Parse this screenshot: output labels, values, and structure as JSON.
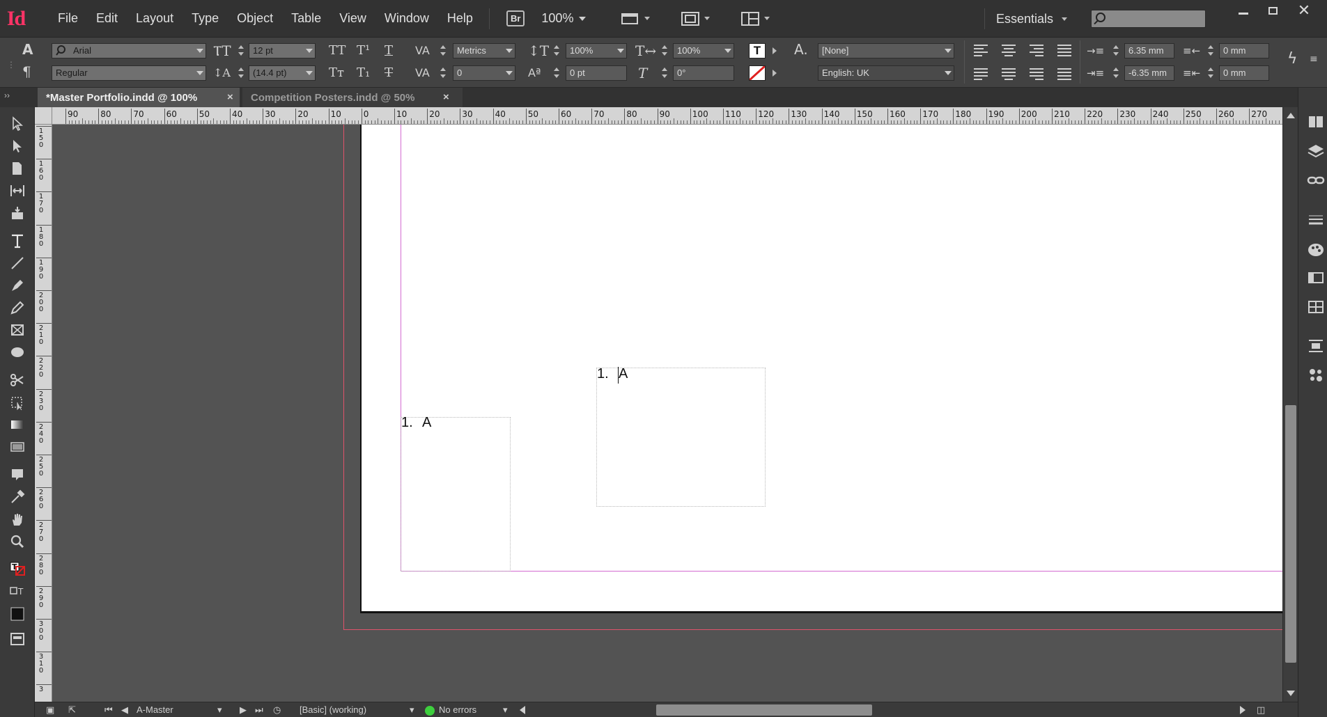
{
  "app": {
    "logo": "Id"
  },
  "menu": {
    "items": [
      "File",
      "Edit",
      "Layout",
      "Type",
      "Object",
      "Table",
      "View",
      "Window",
      "Help"
    ],
    "bridge_button": "Br",
    "zoom": "100%",
    "workspace": "Essentials",
    "search_placeholder": ""
  },
  "control_panel": {
    "char_mode_glyph": "A",
    "para_mode_glyph": "¶",
    "font_family": "Arial",
    "font_style": "Regular",
    "font_size": "12 pt",
    "leading": "(14.4 pt)",
    "kerning": "Metrics",
    "tracking": "0",
    "vertical_scale": "100%",
    "horizontal_scale": "100%",
    "baseline_shift": "0 pt",
    "skew": "0°",
    "char_style": "[None]",
    "language": "English: UK",
    "left_indent": "6.35 mm",
    "first_line_indent": "-6.35 mm",
    "right_indent": "0 mm",
    "last_line_indent": "0 mm"
  },
  "tabs": [
    {
      "label": "*Master Portfolio.indd @ 100%",
      "active": true
    },
    {
      "label": "Competition Posters.indd @ 50%",
      "active": false
    }
  ],
  "ruler_h": [
    "90",
    "80",
    "70",
    "60",
    "50",
    "40",
    "30",
    "20",
    "10",
    "0",
    "10",
    "20",
    "30",
    "40",
    "50",
    "60",
    "70",
    "80",
    "90",
    "100",
    "110",
    "120",
    "130",
    "140",
    "150",
    "160",
    "170",
    "180",
    "190",
    "200",
    "210",
    "220",
    "230",
    "240",
    "250",
    "260",
    "270"
  ],
  "ruler_v": [
    "150",
    "160",
    "170",
    "180",
    "190",
    "200",
    "210",
    "220",
    "230",
    "240",
    "250",
    "260",
    "270",
    "280",
    "290",
    "300",
    "310",
    "3"
  ],
  "frames": [
    {
      "number": "1.",
      "text": "A"
    },
    {
      "number": "1.",
      "text": "A"
    }
  ],
  "status": {
    "page": "A-Master",
    "preflight_profile": "[Basic] (working)",
    "preflight": "No errors"
  },
  "colors": {
    "accent": "#ff3366",
    "bleed_guide": "#e0536b",
    "margin_guide": "#d36ad0",
    "preflight_ok": "#3ecf3e"
  }
}
